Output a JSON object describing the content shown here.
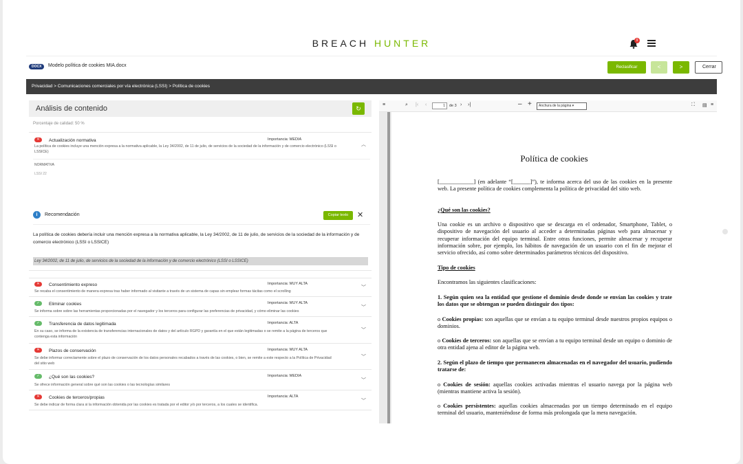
{
  "brand": {
    "part1": "BREACH",
    "part2": "HUNTER"
  },
  "header": {
    "notification_count": "9"
  },
  "file": {
    "badge": "DOCX",
    "name": "Modelo política de cookies MIA.docx",
    "reclasificar_label": "Reclasificar",
    "prev_label": "<",
    "next_label": ">",
    "close_label": "Cerrar"
  },
  "breadcrumb": "Privacidad > Comunicaciones comerciales por vía electrónica (LSSI) > Política de cookies",
  "analysis": {
    "title": "Análisis de contenido",
    "refresh_icon": "↻",
    "quality": "Porcentaje de calidad: 50 %",
    "expanded": {
      "status": "fail",
      "title": "Actualización normativa",
      "importance": "Importancia: MEDIA",
      "description": "La política de cookies incluye una mención expresa a la normativa aplicable, la Ley 34/2002, de 11 de julio, de servicios de la sociedad de la información y de comercio electrónico (LSSI o LSSICE)",
      "normativa_label": "NORMATIVA",
      "normativa_value": "LSSI 22",
      "recommendation_title": "Recomendación",
      "copy_label": "Copiar texto",
      "recommendation_text": "La política de cookies debería incluir una mención expresa a la normativa aplicable, la Ley 34/2002, de 11 de julio, de servicios de la sociedad de la información y de comercio electrónico (LSSI o LSSICE)",
      "legal_ref": "Ley 34/2002, de 11 de julio, de servicios de la sociedad de la información y de comercio electrónico (LSSI o LSSICE)"
    },
    "items": [
      {
        "status": "fail",
        "title": "Consentimiento expreso",
        "importance": "Importancia: MUY ALTA",
        "description": "Se recaba el consentimiento de manera expresa tras haber informado al visitante a través de un sistema de capas sin emplear formas tácitas como el scrolling"
      },
      {
        "status": "ok",
        "title": "Eliminar cookies",
        "importance": "Importancia: MUY ALTA",
        "description": "Se informa sobre sobre las herramientas proporcionadas por el navegador y los terceros para configurar las preferencias de privacidad, y cómo eliminar las cookies"
      },
      {
        "status": "ok",
        "title": "Transferencia de datos legitimada",
        "importance": "Importancia: ALTA",
        "description": "En su caso, se informa de la existencia de transferencias internacionales de datos y del artículo RGPD y garantía en el que están legitimadas o se remite a la página de terceros que contenga esta información"
      },
      {
        "status": "fail",
        "title": "Plazos de conservación",
        "importance": "Importancia: MUY ALTA",
        "description": "Se debe informar correctamente sobre el plazo de conservación de los datos personales recabados a través de las cookies, o bien, se remite a este respecto a la Política de Privacidad del sitio web"
      },
      {
        "status": "ok",
        "title": "¿Qué son las cookies?",
        "importance": "Importancia: MEDIA",
        "description": "Se ofrece información general sobre qué son las cookies o las tecnologías similares"
      },
      {
        "status": "fail",
        "title": "Cookies de terceros/propias",
        "importance": "Importancia: ALTA",
        "description": "Se debe indicar de forma clara si la información obtenida por las cookies es tratada por el editor y/o por terceros, a los cuales se identifica."
      }
    ]
  },
  "viewer": {
    "page_current": "1",
    "page_total": "de 3",
    "zoom": "Anchura de la página"
  },
  "document": {
    "title": "Política de cookies",
    "p1": "[____________] (en adelante “[______]”), te informa acerca del uso de las cookies en la presente web. La presente política de cookies complementa la política de privacidad del sitio web.",
    "h1": "¿Qué son las cookies?",
    "p2": "Una cookie es un archivo o dispositivo que se descarga en el ordenador, Smartphone, Tablet, o dispositivo de navegación del usuario al acceder a determinadas páginas web para almacenar y recuperar información del equipo terminal. Entre otras funciones, permite almacenar y recuperar información sobre, por ejemplo, los hábitos de navegación de un usuario con el fin de mejorar el servicio ofrecido, así como sobre determinados parámetros técnicos del dispositivo.",
    "h2": "Tipo de cookies",
    "p3": "Encontramos las siguientes clasificaciones:",
    "p4": "1. Según quien sea la entidad que gestione el dominio desde donde se envían las cookies y trate los datos que se obtengan se pueden distinguir dos tipos:",
    "p5_bold": "Cookies propias:",
    "p5": " son aquellas que se envían a tu equipo terminal desde nuestros propios equipos o dominios.",
    "p6_bold": "Cookies de terceros:",
    "p6": " son aquellas que se envían a tu equipo terminal desde un equipo o dominio de otra entidad ajena al editor de la página web.",
    "p7": "2. Según el plazo de tiempo que permanecen almacenadas en el navegador del usuario, pudiendo tratarse de:",
    "p8_bold": "Cookies de sesión:",
    "p8": " aquellas cookies activadas mientras el usuario navega por la página web (mientras mantiene activa la sesión).",
    "p9_bold": "Cookies persistentes:",
    "p9": " aquellas cookies almacenadas por un tiempo determinado en el equipo terminal del usuario, manteniéndose de forma más prolongada que la mera navegación."
  }
}
